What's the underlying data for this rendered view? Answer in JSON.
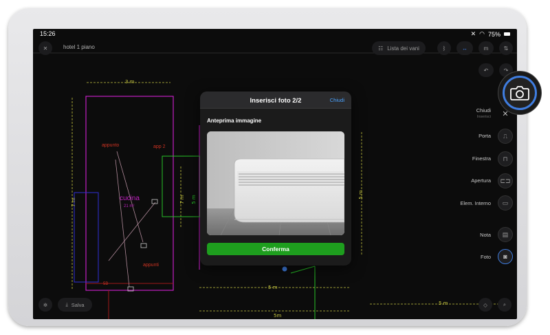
{
  "status_bar": {
    "time": "15:26",
    "battery": "75%"
  },
  "header": {
    "title": "hotel 1 piano",
    "room_list_label": "Lista dei vani",
    "unit_label": "m"
  },
  "plan": {
    "dims": [
      "3 m",
      "7 m",
      "7 m",
      "5 m",
      "5 m",
      "5 m",
      "5m",
      "5 m"
    ],
    "labels": [
      "appunto",
      "app 2",
      "cucina",
      "21 m²",
      "appunti",
      "5B"
    ]
  },
  "modal": {
    "title": "Inserisci foto 2/2",
    "close_label": "Chiudi",
    "preview_label": "Anteprima immagine",
    "confirm_label": "Conferma"
  },
  "side_menu": {
    "close_label": "Chiudi",
    "close_sub": "Inserisci",
    "items": [
      {
        "label": "Porta",
        "icon": "door-icon"
      },
      {
        "label": "Finestra",
        "icon": "window-icon"
      },
      {
        "label": "Apertura",
        "icon": "opening-icon"
      },
      {
        "label": "Elem. Interno",
        "icon": "interior-element-icon"
      },
      {
        "label": "Nota",
        "icon": "note-icon"
      },
      {
        "label": "Foto",
        "icon": "photo-icon"
      }
    ]
  },
  "bottom": {
    "save_label": "Salva"
  },
  "colors": {
    "accent": "#3f7de0",
    "confirm": "#1e9e1e",
    "link": "#4aa3ff",
    "walls": "#c41fc4",
    "dims": "#c8c840",
    "green_lines": "#27c427"
  }
}
